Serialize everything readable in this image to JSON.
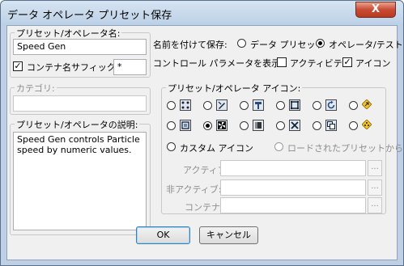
{
  "window": {
    "title": "データ オペレータ プリセット保存",
    "close_glyph": "X"
  },
  "name_group": {
    "label": "プリセット/オペレータ名:",
    "name_value": "Speed Gen",
    "suffix_checkbox_label": "コンテナ名サフィックス:",
    "suffix_checked": true,
    "suffix_value": "*"
  },
  "category_group": {
    "label": "カテゴリ:",
    "value": ""
  },
  "description_group": {
    "label": "プリセット/オペレータの説明:",
    "text": "Speed Gen controls Particle speed by numeric values."
  },
  "save_as": {
    "label": "名前を付けて保存:",
    "options": [
      "データ プリセット",
      "オペレータ/テスト"
    ],
    "selected": "オペレータ/テスト"
  },
  "display_params": {
    "label": "コントロール パラメータを表示:",
    "activity_label": "アクティビティ",
    "activity_checked": false,
    "icon_label": "アイコン",
    "icon_checked": true
  },
  "icon_group": {
    "label": "プリセット/オペレータ アイコン:",
    "row1": [
      "dots-grid-icon",
      "pen-icon",
      "hammer-icon",
      "frame-icon",
      "refresh-icon",
      "diamond-arrow-icon"
    ],
    "row2": [
      "book-icon",
      "pinwheel-icon",
      "cylinder-icon",
      "cross-icon",
      "copy-icon",
      "diamond-dots-icon"
    ],
    "selected": "pinwheel-icon",
    "custom_label": "カスタム アイコン",
    "loaded_label": "ロードされたプリセットから",
    "active_label": "アクティブ:",
    "inactive_label": "非アクティブ:",
    "container_label": "コンテナ:",
    "browse_glyph": "..."
  },
  "buttons": {
    "ok": "OK",
    "cancel": "キャンセル"
  }
}
